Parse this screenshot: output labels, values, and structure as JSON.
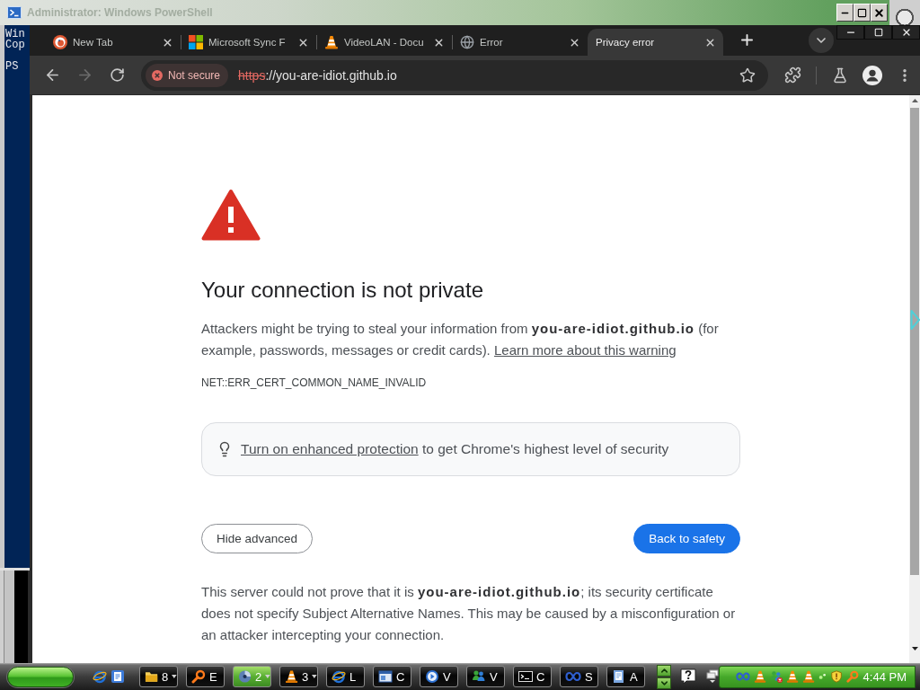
{
  "console_window": {
    "title": "Administrator: Windows PowerShell",
    "lines": [
      "Win",
      "Cop",
      "PS"
    ]
  },
  "browser": {
    "tabs": [
      {
        "kind": "circle",
        "title": "New Tab",
        "selected": false
      },
      {
        "kind": "squares",
        "title": "Microsoft Sync F",
        "selected": false
      },
      {
        "kind": "cone",
        "title": "VideoLAN - Docu",
        "selected": false
      },
      {
        "kind": "globe",
        "title": "Error",
        "selected": false
      },
      {
        "kind": "plain",
        "title": "Privacy error",
        "selected": true
      }
    ],
    "toolbar": {
      "forward_disabled": true,
      "security_chip": "Not secure",
      "url_scheme": "https",
      "url_rest": "://you-are-idiot.github.io",
      "insecure_scheme": true
    }
  },
  "page": {
    "heading": "Your connection is not private",
    "intro": "Attackers might be trying to steal your information from **you-are-idiot.github.io** (for example, passwords, messages or credit cards).",
    "learn_more_link": "Learn more about this warning",
    "error_code": "NET::ERR_CERT_COMMON_NAME_INVALID",
    "protection_link": "Turn on enhanced protection",
    "protection_text": "to get Chrome's highest level of security",
    "buttons": [
      {
        "kind": "outline",
        "label": "Hide advanced"
      },
      {
        "kind": "primary",
        "label": "Back to safety"
      }
    ],
    "details": "This server could not prove that it is **you-are-idiot.github.io**; its security certificate does not specify Subject Alternative Names. This may be caused by a misconfiguration or an attacker intercepting your connection."
  },
  "taskbar": {
    "tasks": [
      {
        "kind": "folder",
        "label": "8",
        "grouped": true,
        "selected": false
      },
      {
        "kind": "magnifier",
        "label": "E",
        "grouped": false,
        "selected": false
      },
      {
        "kind": "disc",
        "label": "2",
        "grouped": true,
        "selected": true
      },
      {
        "kind": "cone",
        "label": "3",
        "grouped": true,
        "selected": false
      },
      {
        "kind": "browser",
        "label": "L",
        "grouped": false,
        "selected": false
      },
      {
        "kind": "window",
        "label": "C",
        "grouped": false,
        "selected": false
      },
      {
        "kind": "media",
        "label": "V",
        "grouped": false,
        "selected": false
      },
      {
        "kind": "people",
        "label": "V",
        "grouped": false,
        "selected": false
      },
      {
        "kind": "console",
        "label": "C",
        "grouped": false,
        "selected": false
      },
      {
        "kind": "infinity",
        "label": "S",
        "grouped": false,
        "selected": false
      },
      {
        "kind": "document",
        "label": "A",
        "grouped": false,
        "selected": false
      }
    ],
    "clock": "4:44 PM"
  }
}
